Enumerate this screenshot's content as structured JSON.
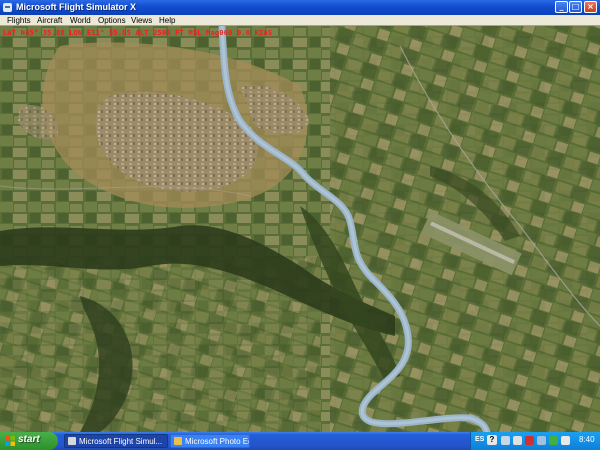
{
  "window": {
    "title": "Microsoft Flight Simulator X",
    "controls": {
      "minimize": "_",
      "maximize": "□",
      "close": "×"
    }
  },
  "menu": {
    "items": [
      "Flights",
      "Aircraft",
      "World",
      "Options",
      "Views",
      "Help"
    ]
  },
  "overlay": {
    "text": "LAT N45° 35.88  LON E11° 55.05  ALT 2500 FT MSL  Mag060 0.0 KIAS",
    "color": "#ee2020"
  },
  "taskbar": {
    "start_label": "start",
    "tasks": [
      {
        "label": "Microsoft Flight Simul...",
        "icon": "fsx-app-icon",
        "active": true
      },
      {
        "label": "Microsoft Photo Editor",
        "icon": "photo-editor-icon",
        "active": false
      }
    ],
    "tray": {
      "language": "ES",
      "help": "?",
      "icons": [
        "network-icon",
        "volume-icon",
        "shield-icon",
        "monitor-icon",
        "messenger-icon",
        "speaker-icon"
      ],
      "clock": "8:40"
    }
  },
  "colors": {
    "titlebar": "#1450d2",
    "menubar": "#ece9d8",
    "taskbar": "#245edb",
    "start_button": "#3a9e3a",
    "river": "#9ab4c8",
    "terrain_green": "#546a34",
    "terrain_tan": "#a48c58"
  }
}
